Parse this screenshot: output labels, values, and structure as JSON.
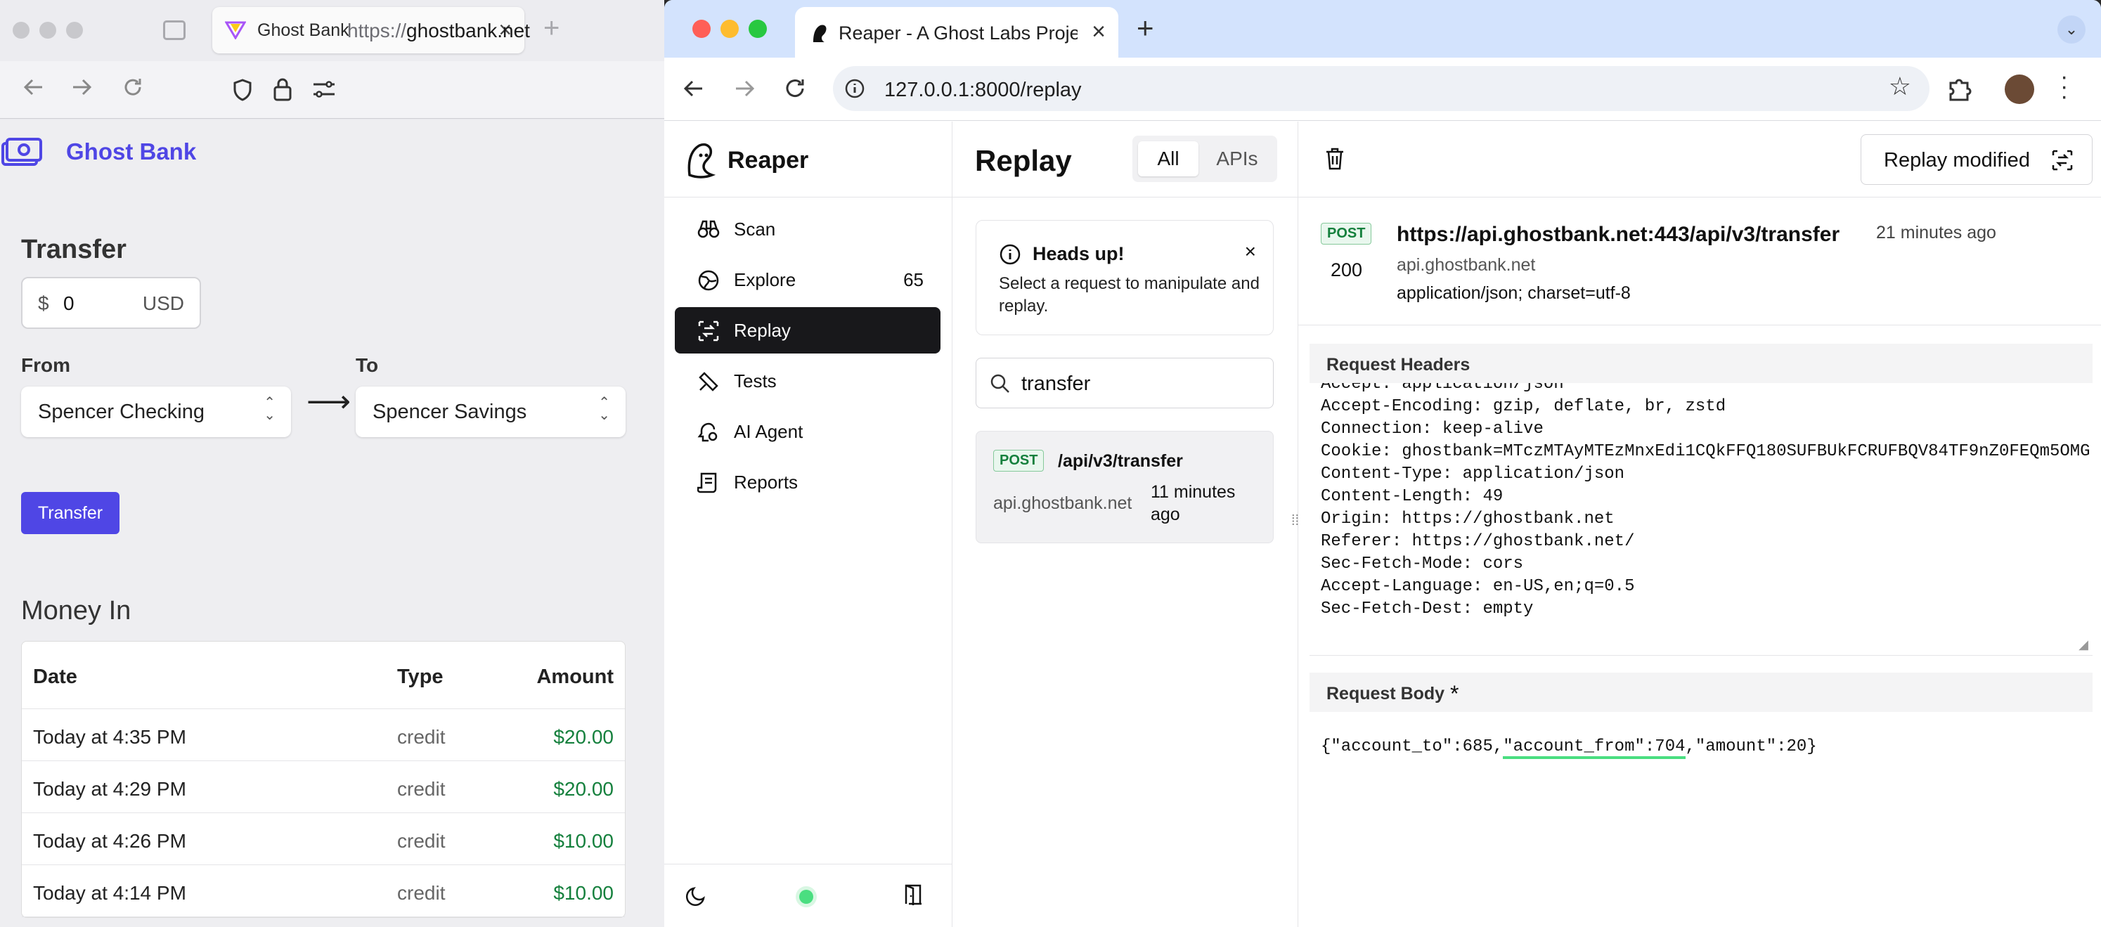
{
  "left_browser": {
    "tab_title": "Ghost Bank",
    "tab_close": "×",
    "new_tab": "+",
    "url_prefix": "https://",
    "url_host": "ghostbank.net"
  },
  "ghost_bank": {
    "brand": "Ghost Bank",
    "transfer_heading": "Transfer",
    "currency_symbol": "$",
    "amount_value": "0",
    "currency_code": "USD",
    "from_label": "From",
    "to_label": "To",
    "from_account": "Spencer Checking",
    "to_account": "Spencer Savings",
    "arrow": "⟶",
    "transfer_button": "Transfer",
    "money_in_heading": "Money In",
    "table_headers": {
      "date": "Date",
      "type": "Type",
      "amount": "Amount"
    },
    "transactions": [
      {
        "date": "Today at 4:35 PM",
        "type": "credit",
        "amount": "$20.00"
      },
      {
        "date": "Today at 4:29 PM",
        "type": "credit",
        "amount": "$20.00"
      },
      {
        "date": "Today at 4:26 PM",
        "type": "credit",
        "amount": "$10.00"
      },
      {
        "date": "Today at 4:14 PM",
        "type": "credit",
        "amount": "$10.00"
      }
    ],
    "accent_color": "#4f46e5"
  },
  "right_browser": {
    "tab_title": "Reaper - A Ghost Labs Project",
    "tab_close": "×",
    "new_tab": "+",
    "url": "127.0.0.1:8000/replay"
  },
  "reaper": {
    "brand": "Reaper",
    "nav": [
      {
        "label": "Scan",
        "icon": "binoculars-icon"
      },
      {
        "label": "Explore",
        "icon": "globe-icon",
        "count": "65"
      },
      {
        "label": "Replay",
        "icon": "replay-icon",
        "active": true
      },
      {
        "label": "Tests",
        "icon": "tests-icon"
      },
      {
        "label": "AI Agent",
        "icon": "ai-agent-icon"
      },
      {
        "label": "Reports",
        "icon": "reports-icon"
      }
    ],
    "replay": {
      "title": "Replay",
      "filter_all": "All",
      "filter_apis": "APIs",
      "alert_title": "Heads up!",
      "alert_body": "Select a request to manipulate and replay.",
      "alert_close": "×",
      "search_value": "transfer",
      "request": {
        "method": "POST",
        "path": "/api/v3/transfer",
        "host": "api.ghostbank.net",
        "time": "11 minutes ago"
      }
    },
    "detail": {
      "replay_button": "Replay modified",
      "method": "POST",
      "url": "https://api.ghostbank.net:443/api/v3/transfer",
      "time": "21 minutes ago",
      "status": "200",
      "host": "api.ghostbank.net",
      "content_type": "application/json; charset=utf-8",
      "headers_title": "Request Headers",
      "headers_lines": [
        "Accept: application/json",
        "Accept-Encoding: gzip, deflate, br, zstd",
        "Connection: keep-alive",
        "Cookie: ghostbank=MTczMTAyMTEzMnxEdi1CQkFFQ180SUFBUkFCRUFBQV84TF9nZ0FEQm5OMG",
        "Content-Type: application/json",
        "Content-Length: 49",
        "Origin: https://ghostbank.net",
        "Referer: https://ghostbank.net/",
        "Sec-Fetch-Mode: cors",
        "Accept-Language: en-US,en;q=0.5",
        "Sec-Fetch-Dest: empty"
      ],
      "body_title": "Request Body",
      "body_modified_marker": "*",
      "body_part1": "{\"account_to\":685,",
      "body_part2": "\"account_from\":704",
      "body_part3": ",\"amount\":20}"
    }
  }
}
